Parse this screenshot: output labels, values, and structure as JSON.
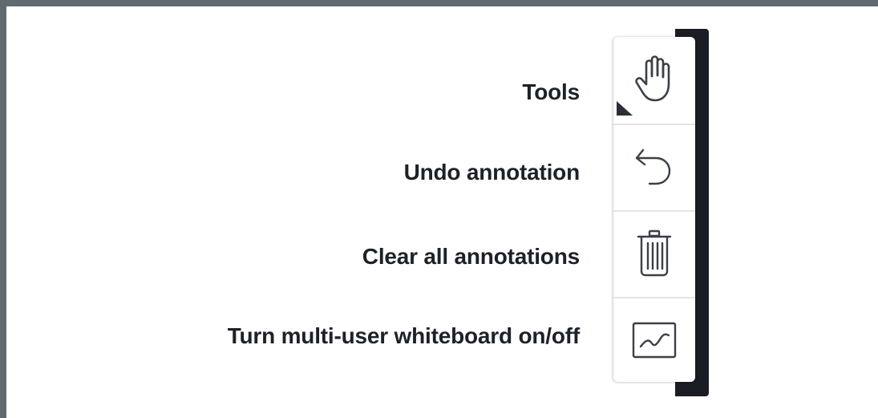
{
  "toolbar": {
    "items": [
      {
        "label": "Tools",
        "icon": "hand-icon"
      },
      {
        "label": "Undo annotation",
        "icon": "undo-icon"
      },
      {
        "label": "Clear all annotations",
        "icon": "trash-icon"
      },
      {
        "label": "Turn multi-user whiteboard on/off",
        "icon": "whiteboard-icon"
      }
    ]
  },
  "colors": {
    "frame": "#5f6b70",
    "bracket": "#1a1e24",
    "icon_stroke": "#3a4046",
    "label_text": "#1d2228"
  }
}
